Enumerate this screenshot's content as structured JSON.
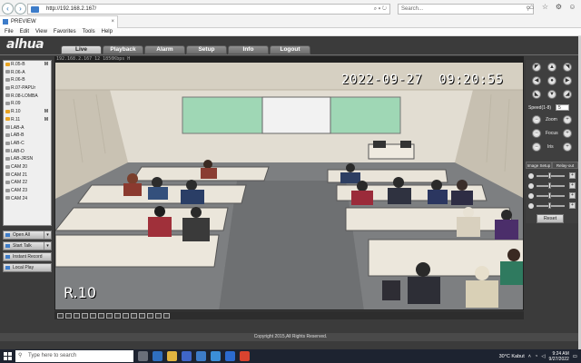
{
  "browser": {
    "address": "http://192.168.2.167/",
    "search_placeholder": "Search...",
    "tab_title": "PREVIEW",
    "menu": [
      "File",
      "Edit",
      "View",
      "Favorites",
      "Tools",
      "Help"
    ]
  },
  "app": {
    "logo": "alhua",
    "nav_tabs": [
      "Live",
      "Playback",
      "Alarm",
      "Setup",
      "Info",
      "Logout"
    ],
    "active_tab": "Live",
    "camera_list": [
      {
        "label": "R.05-B",
        "marker": "M",
        "active": true
      },
      {
        "label": "R.06-A",
        "marker": "",
        "active": false
      },
      {
        "label": "R.06-B",
        "marker": "",
        "active": false
      },
      {
        "label": "R.07-PAPUr",
        "marker": "",
        "active": false
      },
      {
        "label": "R.08-LOMBA",
        "marker": "",
        "active": false
      },
      {
        "label": "R.09",
        "marker": "",
        "active": false
      },
      {
        "label": "R.10",
        "marker": "M",
        "active": true
      },
      {
        "label": "R.11",
        "marker": "M",
        "active": true
      },
      {
        "label": "LAB-A",
        "marker": "",
        "active": false
      },
      {
        "label": "LAB-B",
        "marker": "",
        "active": false
      },
      {
        "label": "LAB-C",
        "marker": "",
        "active": false
      },
      {
        "label": "LAB-D",
        "marker": "",
        "active": false
      },
      {
        "label": "LAB-JRSN",
        "marker": "",
        "active": false
      },
      {
        "label": "CAM 20",
        "marker": "",
        "active": false
      },
      {
        "label": "CAM 21",
        "marker": "",
        "active": false
      },
      {
        "label": "CAM 22",
        "marker": "",
        "active": false
      },
      {
        "label": "CAM 23",
        "marker": "",
        "active": false
      },
      {
        "label": "CAM 24",
        "marker": "",
        "active": false
      }
    ],
    "left_buttons": [
      "Open All",
      "Start Talk",
      "Instant Record",
      "Local Play"
    ],
    "video": {
      "info": "192.168.2.167 12 1850Kbps H",
      "timestamp": "2022-09-27  09:20:55",
      "room_label": "R.10"
    },
    "ptz": {
      "speed_label": "Speed(1-8)",
      "speed_value": "5",
      "zoom_label": "Zoom",
      "focus_label": "Focus",
      "iris_label": "Iris"
    },
    "image_tabs": [
      "Image Setup",
      "Relay-out"
    ],
    "reset_label": "Reset",
    "footer": "Copyright 2015,All Rights Reserved."
  },
  "taskbar": {
    "search_placeholder": "Type here to search",
    "weather": "30°C  Kabut",
    "time": "9:24 AM",
    "date": "9/27/2022"
  },
  "colors": {
    "app_bg": "#3b3b3b",
    "accent": "#3d7cc9",
    "active_cam": "#e8a322"
  }
}
